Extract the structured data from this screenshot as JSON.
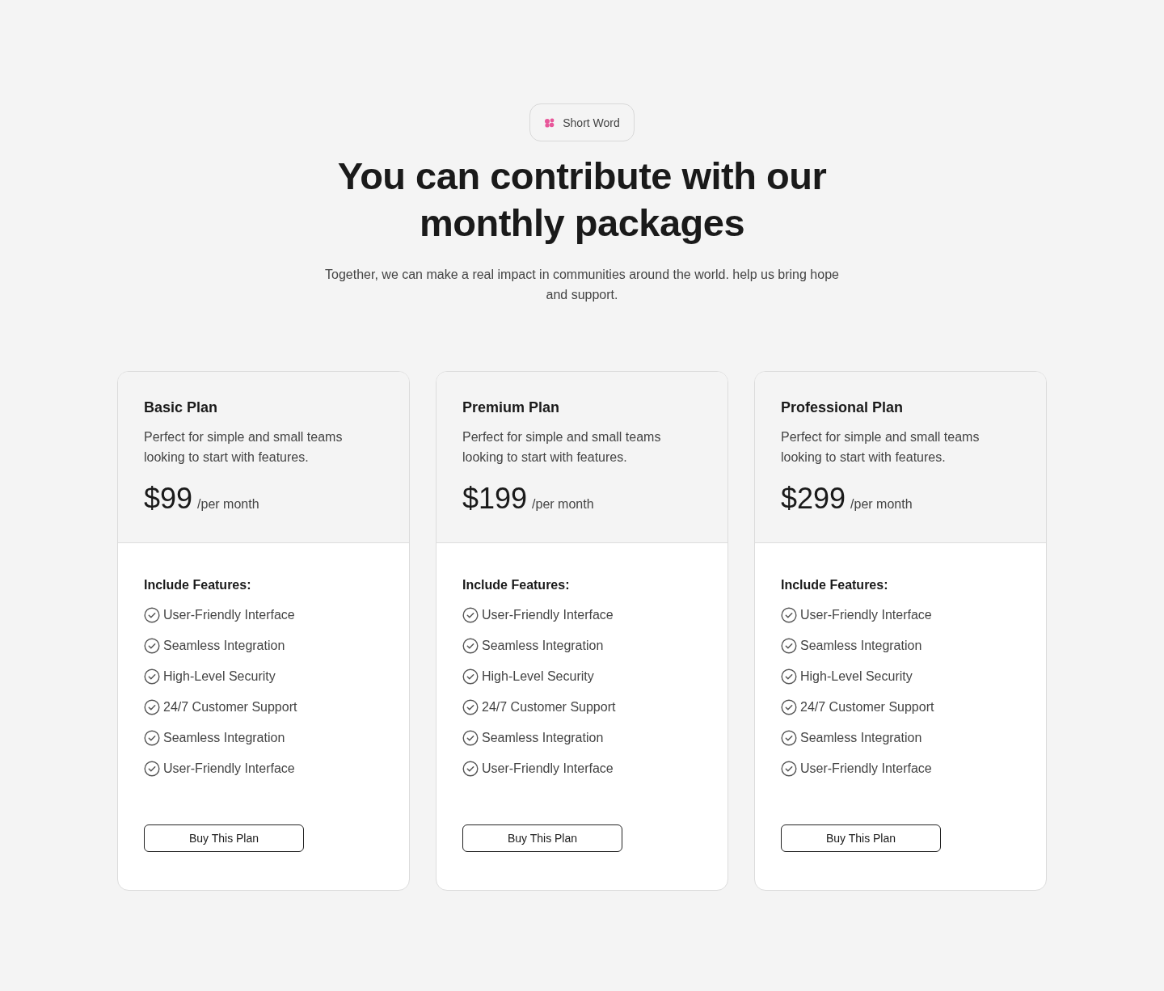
{
  "badge": {
    "label": "Short Word"
  },
  "heading": "You can contribute with our monthly packages",
  "subheading": "Together, we can make a real impact in communities around the world. help us bring hope and support.",
  "plans": [
    {
      "name": "Basic Plan",
      "description": "Perfect for simple and small teams looking to start with features.",
      "price": "$99",
      "period": "/per month",
      "features_title": "Include Features:",
      "features": [
        "User-Friendly Interface",
        "Seamless Integration",
        "High-Level Security",
        "24/7 Customer Support",
        "Seamless Integration",
        "User-Friendly Interface"
      ],
      "button": "Buy This Plan"
    },
    {
      "name": "Premium Plan",
      "description": "Perfect for simple and small teams looking to start with features.",
      "price": "$199",
      "period": "/per month",
      "features_title": "Include Features:",
      "features": [
        "User-Friendly Interface",
        "Seamless Integration",
        "High-Level Security",
        "24/7 Customer Support",
        "Seamless Integration",
        "User-Friendly Interface"
      ],
      "button": "Buy This Plan"
    },
    {
      "name": "Professional Plan",
      "description": "Perfect for simple and small teams looking to start with features.",
      "price": "$299",
      "period": "/per month",
      "features_title": "Include Features:",
      "features": [
        "User-Friendly Interface",
        "Seamless Integration",
        "High-Level Security",
        "24/7 Customer Support",
        "Seamless Integration",
        "User-Friendly Interface"
      ],
      "button": "Buy This Plan"
    }
  ]
}
